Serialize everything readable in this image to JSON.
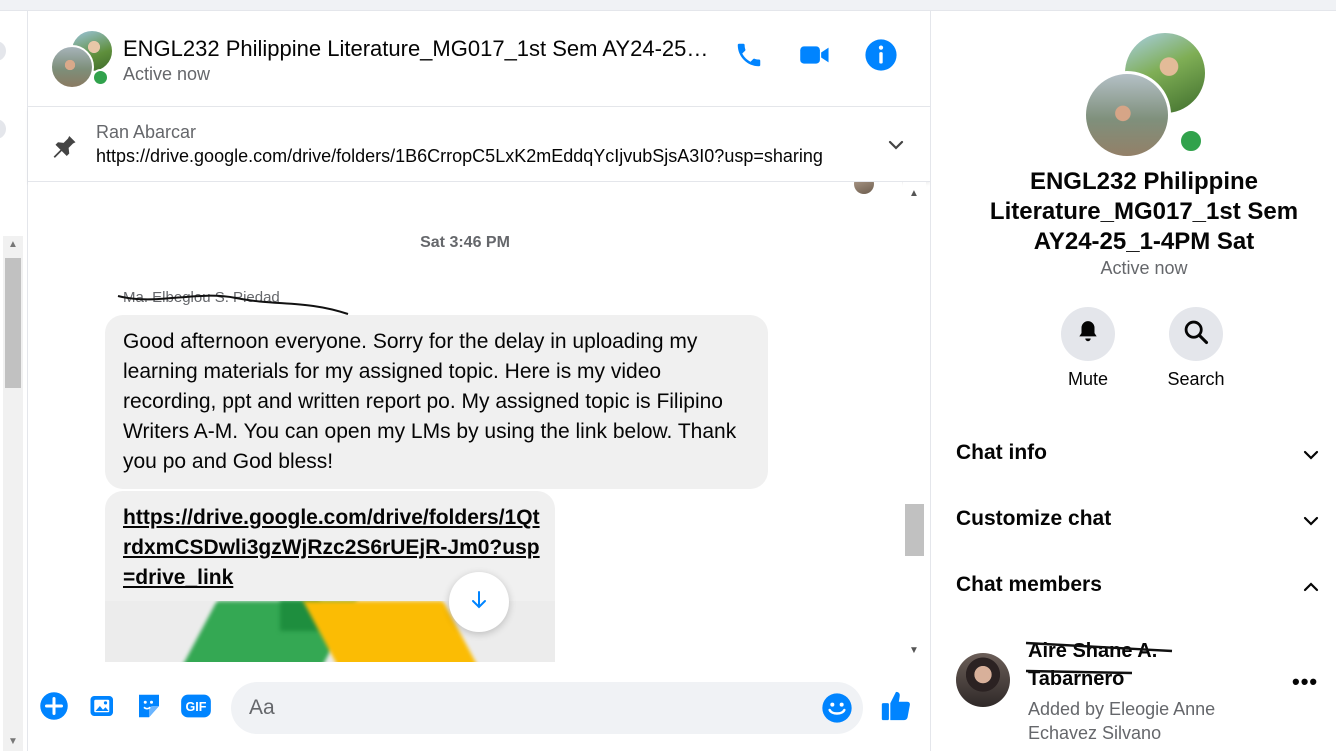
{
  "header": {
    "title": "ENGL232 Philippine Literature_MG017_1st Sem AY24-25_1-4PM Sat",
    "status": "Active now",
    "icons": [
      "phone-icon",
      "video-icon",
      "info-icon"
    ]
  },
  "pinned": {
    "sender": "Ran Abarcar",
    "link": "https://drive.google.com/drive/folders/1B6CrropC5LxK2mEddqYcIjvubSjsA3I0?usp=sharing"
  },
  "conversation": {
    "timestamp": "Sat 3:46 PM",
    "sender": "Ma. Elbeglou S. Piedad",
    "message": "Good afternoon everyone. Sorry for the delay in uploading my learning materials for my assigned topic. Here is my video recording, ppt and written report po. My assigned topic is Filipino Writers A-M. You can open my LMs by using the link below. Thank you po and God bless!",
    "link_message": "https://drive.google.com/drive/folders/1QtrdxmCSDwli3gzWjRzc2S6rUEjR-Jm0?usp=drive_link"
  },
  "composer": {
    "placeholder": "Aa",
    "icons": [
      "add-icon",
      "photo-icon",
      "sticker-icon",
      "gif-icon",
      "emoji-icon",
      "like-icon"
    ],
    "gif_label": "GIF"
  },
  "right_panel": {
    "name": "ENGL232 Philippine Literature_MG017_1st Sem AY24-25_1-4PM Sat",
    "status": "Active now",
    "actions": [
      {
        "label": "Mute",
        "icon": "bell-icon"
      },
      {
        "label": "Search",
        "icon": "search-icon"
      }
    ],
    "sections": [
      {
        "label": "Chat info",
        "expanded": false
      },
      {
        "label": "Customize chat",
        "expanded": false
      },
      {
        "label": "Chat members",
        "expanded": true
      }
    ],
    "member": {
      "name": "Aire Shane A. Tabarnero",
      "added_by": "Added by Eleogie Anne Echavez Silvano",
      "more": "•••"
    }
  },
  "colors": {
    "accent": "#0084ff",
    "online": "#31a24c",
    "bubble": "#f0f0f0",
    "secondary_text": "#65676b"
  }
}
